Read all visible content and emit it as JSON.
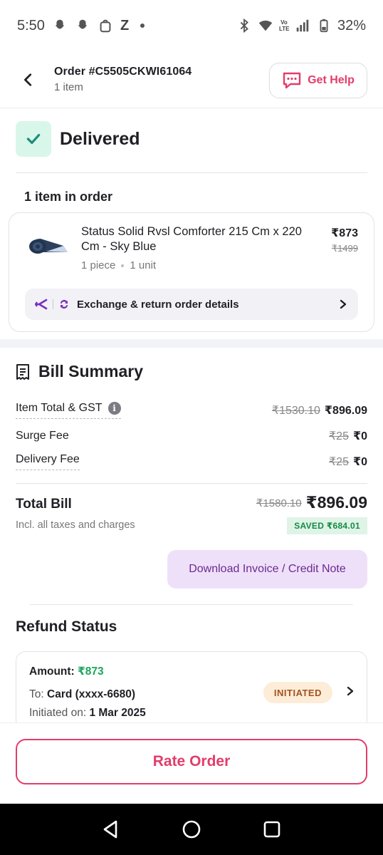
{
  "status_bar": {
    "time": "5:50",
    "z_letter": "Z",
    "battery": "32%",
    "volte": "Vo LTE"
  },
  "header": {
    "order_id": "Order #C5505CKWI61064",
    "item_count": "1 item",
    "help_label": "Get Help"
  },
  "delivery": {
    "status": "Delivered"
  },
  "items_section": {
    "heading": "1 item in order",
    "items": [
      {
        "name": "Status Solid Rvsl Comforter 215 Cm x 220 Cm - Sky Blue",
        "pieces": "1 piece",
        "units": "1 unit",
        "price": "₹873",
        "mrp": "₹1499"
      }
    ],
    "exchange_label": "Exchange & return order details"
  },
  "bill": {
    "title": "Bill Summary",
    "rows": [
      {
        "label": "Item Total & GST",
        "original": "₹1530.10",
        "final": "₹896.09"
      },
      {
        "label": "Surge Fee",
        "original": "₹25",
        "final": "₹0"
      },
      {
        "label": "Delivery Fee",
        "original": "₹25",
        "final": "₹0"
      }
    ],
    "total_label": "Total Bill",
    "total_sub": "Incl. all taxes and charges",
    "total_original": "₹1580.10",
    "total_final": "₹896.09",
    "saved": "SAVED ₹684.01",
    "invoice_label": "Download Invoice / Credit Note"
  },
  "refund": {
    "title": "Refund Status",
    "amount_label": "Amount:",
    "amount": "₹873",
    "to_label": "To:",
    "to_value": "Card (xxxx-6680)",
    "initiated_label": "Initiated on:",
    "initiated_date": "1 Mar 2025",
    "status_badge": "INITIATED"
  },
  "footer": {
    "rate_label": "Rate Order"
  },
  "colors": {
    "accent": "#e23d6a",
    "success": "#1aa65a",
    "invoice_bg": "#efe0fa",
    "purple": "#7b2cbf"
  }
}
